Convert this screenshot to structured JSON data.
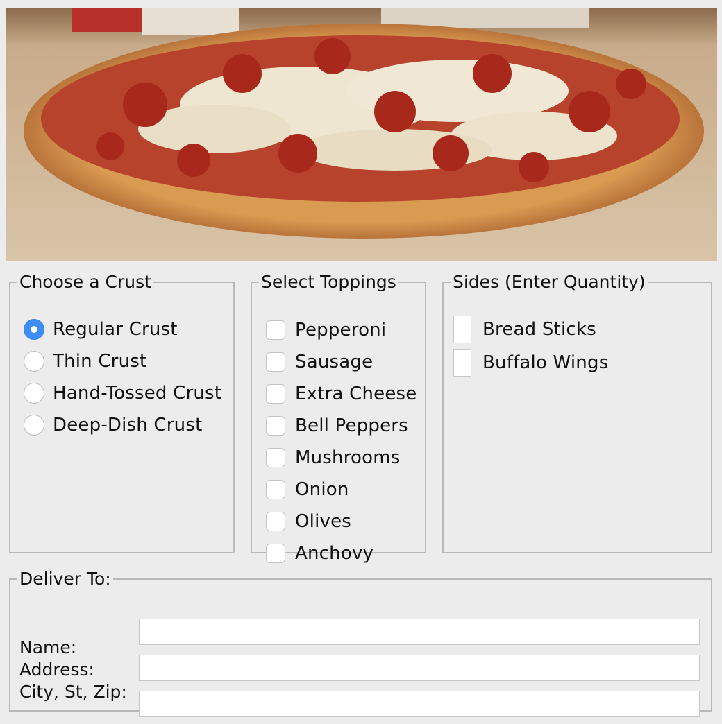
{
  "image": {
    "alt": "pizza-photo"
  },
  "crust": {
    "title": "Choose a Crust",
    "selected": 0,
    "options": [
      "Regular Crust",
      "Thin Crust",
      "Hand-Tossed Crust",
      "Deep-Dish Crust"
    ]
  },
  "toppings": {
    "title": "Select Toppings",
    "options": [
      "Pepperoni",
      "Sausage",
      "Extra Cheese",
      "Bell Peppers",
      "Mushrooms",
      "Onion",
      "Olives",
      "Anchovy"
    ]
  },
  "sides": {
    "title": "Sides (Enter Quantity)",
    "items": [
      {
        "label": "Bread Sticks",
        "value": ""
      },
      {
        "label": "Buffalo Wings",
        "value": ""
      }
    ]
  },
  "deliver": {
    "title": "Deliver To:",
    "fields": [
      {
        "label": "Name:",
        "value": ""
      },
      {
        "label": "Address:",
        "value": ""
      },
      {
        "label": "City, St, Zip:",
        "value": ""
      }
    ]
  },
  "colors": {
    "accent": "#3d8ef7",
    "background": "#ececec"
  }
}
